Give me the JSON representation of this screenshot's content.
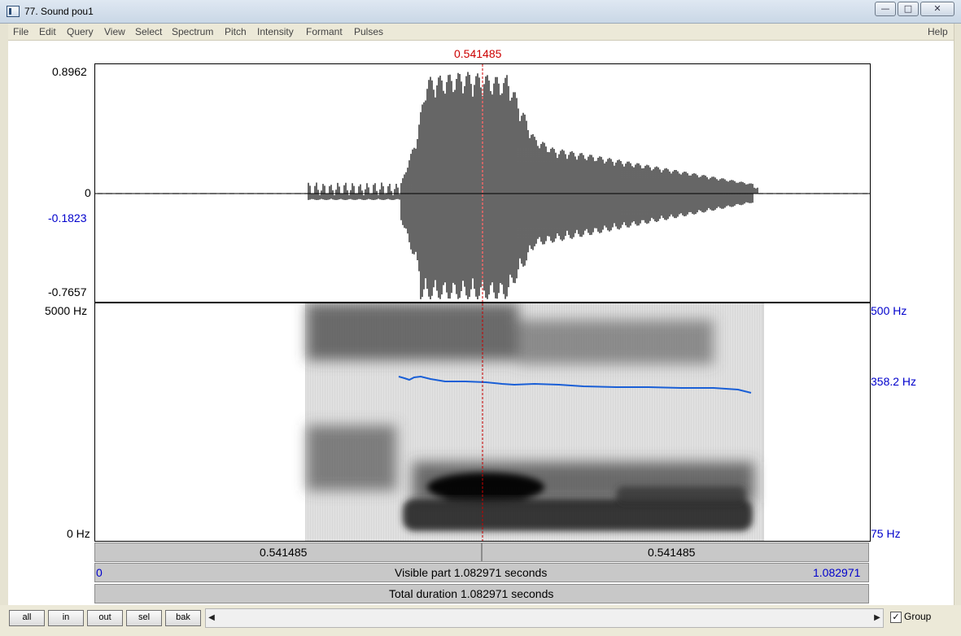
{
  "window": {
    "title": "77. Sound pou1"
  },
  "menu": [
    {
      "label": "File"
    },
    {
      "label": "Edit"
    },
    {
      "label": "Query"
    },
    {
      "label": "View"
    },
    {
      "label": "Select"
    },
    {
      "label": "Spectrum"
    },
    {
      "label": "Pitch"
    },
    {
      "label": "Intensity"
    },
    {
      "label": "Formant"
    },
    {
      "label": "Pulses"
    }
  ],
  "help_label": "Help",
  "cursor": {
    "time_top": "0.541485",
    "time_left": "0.541485",
    "time_right": "0.541485"
  },
  "waveform": {
    "ymax": "0.8962",
    "zero": "0",
    "marker": "-0.1823",
    "ymin": "-0.7657"
  },
  "spectrogram": {
    "fmax": "5000 Hz",
    "fmin": "0 Hz"
  },
  "pitch": {
    "max": "500 Hz",
    "value": "358.2 Hz",
    "min": "75 Hz"
  },
  "visible": {
    "start": "0",
    "label": "Visible part 1.082971 seconds",
    "end": "1.082971"
  },
  "total": {
    "label": "Total duration 1.082971 seconds"
  },
  "buttons": [
    {
      "label": "all"
    },
    {
      "label": "in"
    },
    {
      "label": "out"
    },
    {
      "label": "sel"
    },
    {
      "label": "bak"
    }
  ],
  "group": {
    "label": "Group",
    "checked": "✓"
  },
  "colors": {
    "cursor": "#cc0000",
    "pitch": "#0000cc"
  }
}
